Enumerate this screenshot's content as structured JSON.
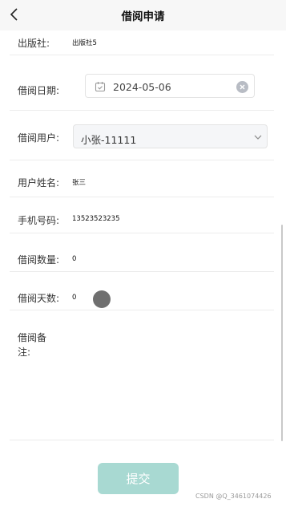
{
  "header": {
    "title": "借阅申请",
    "back_icon": "chevron-left-icon"
  },
  "form": {
    "publisher": {
      "label": "出版社:",
      "value": "出版社5"
    },
    "borrow_date": {
      "label": "借阅日期:",
      "value": "2024-05-06",
      "icon": "calendar-icon",
      "clear_icon": "clear-icon"
    },
    "borrow_user": {
      "label": "借阅用户:",
      "value": "小张-11111",
      "icon": "chevron-down-icon"
    },
    "user_name": {
      "label": "用户姓名:",
      "value": "张三"
    },
    "phone": {
      "label": "手机号码:",
      "value": "13523523235"
    },
    "quantity": {
      "label": "借阅数量:",
      "value": "0"
    },
    "days": {
      "label": "借阅天数:",
      "value": "0"
    },
    "remark": {
      "label_line1": "借阅备",
      "label_line2": "注:"
    }
  },
  "submit_label": "提交",
  "watermark": "CSDN @Q_3461074426",
  "colors": {
    "submit_bg": "#a8d9d2",
    "navbar_bg": "#f7f7f7"
  }
}
